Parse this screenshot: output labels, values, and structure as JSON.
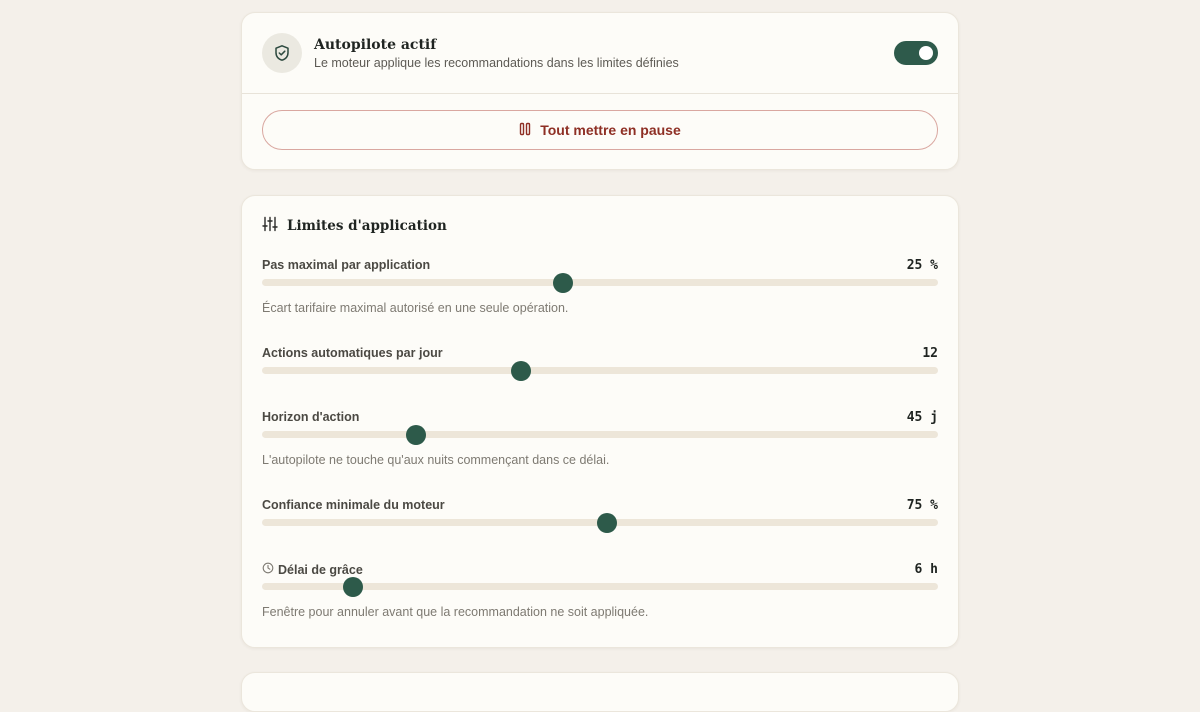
{
  "autopilot": {
    "title": "Autopilote actif",
    "subtitle": "Le moteur applique les recommandations dans les limites définies",
    "enabled": true,
    "shield_icon": "shield-check-icon",
    "pause_label": "Tout mettre en pause",
    "pause_icon": "pause-icon"
  },
  "limits": {
    "title": "Limites d'application",
    "icon": "sliders-icon",
    "sliders": [
      {
        "label": "Pas maximal par application",
        "value": "25 %",
        "fraction": 0.445,
        "help": "Écart tarifaire maximal autorisé en une seule opération."
      },
      {
        "label": "Actions automatiques par jour",
        "value": "12",
        "fraction": 0.383,
        "help": ""
      },
      {
        "label": "Horizon d'action",
        "value": "45 j",
        "fraction": 0.228,
        "help": "L'autopilote ne touche qu'aux nuits commençant dans ce délai."
      },
      {
        "label": "Confiance minimale du moteur",
        "value": "75 %",
        "fraction": 0.51,
        "help": ""
      },
      {
        "label": "Délai de grâce",
        "value": "6 h",
        "fraction": 0.135,
        "help": "Fenêtre pour annuler avant que la recommandation ne soit appliquée.",
        "icon": "clock-icon"
      }
    ]
  },
  "colors": {
    "accent": "#2d5a4a",
    "danger": "#8e2f24",
    "background": "#f4f0ea",
    "card": "#fdfcf8",
    "track": "#ede6d9"
  }
}
